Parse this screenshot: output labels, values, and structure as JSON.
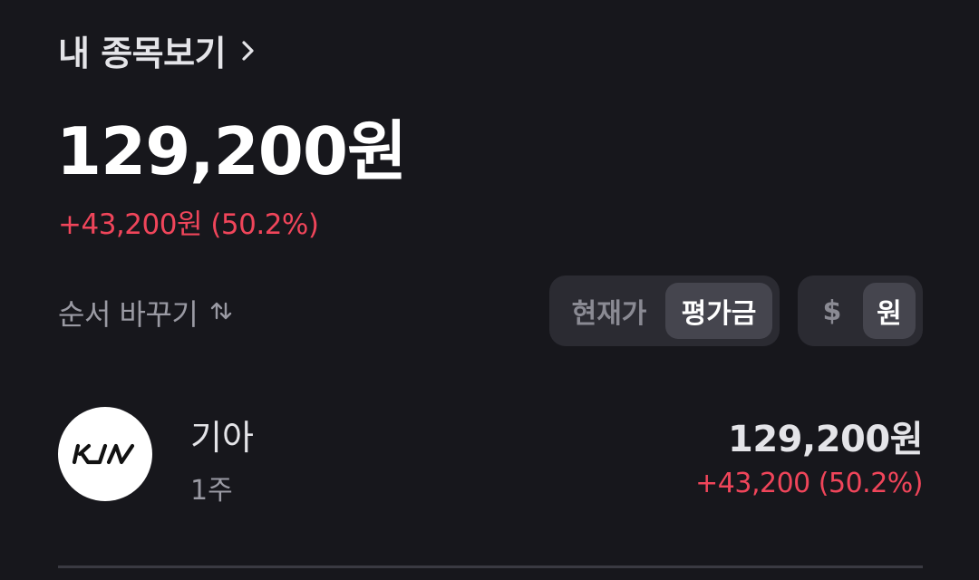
{
  "header": {
    "title": "내 종목보기"
  },
  "summary": {
    "total_value": "129,200원",
    "total_change": "+43,200원 (50.2%)"
  },
  "controls": {
    "sort_label": "순서 바꾸기",
    "view_toggle": {
      "options": [
        "현재가",
        "평가금"
      ],
      "selected": "평가금"
    },
    "currency_toggle": {
      "options": [
        "$",
        "원"
      ],
      "selected": "원"
    }
  },
  "holdings": [
    {
      "name": "기아",
      "quantity": "1주",
      "value": "129,200원",
      "change": "+43,200 (50.2%)",
      "logo_icon": "kia-logo-icon"
    }
  ],
  "colors": {
    "background": "#17171c",
    "positive": "#f0455a",
    "segment_bg": "#2b2b32",
    "segment_active": "#45454e"
  }
}
